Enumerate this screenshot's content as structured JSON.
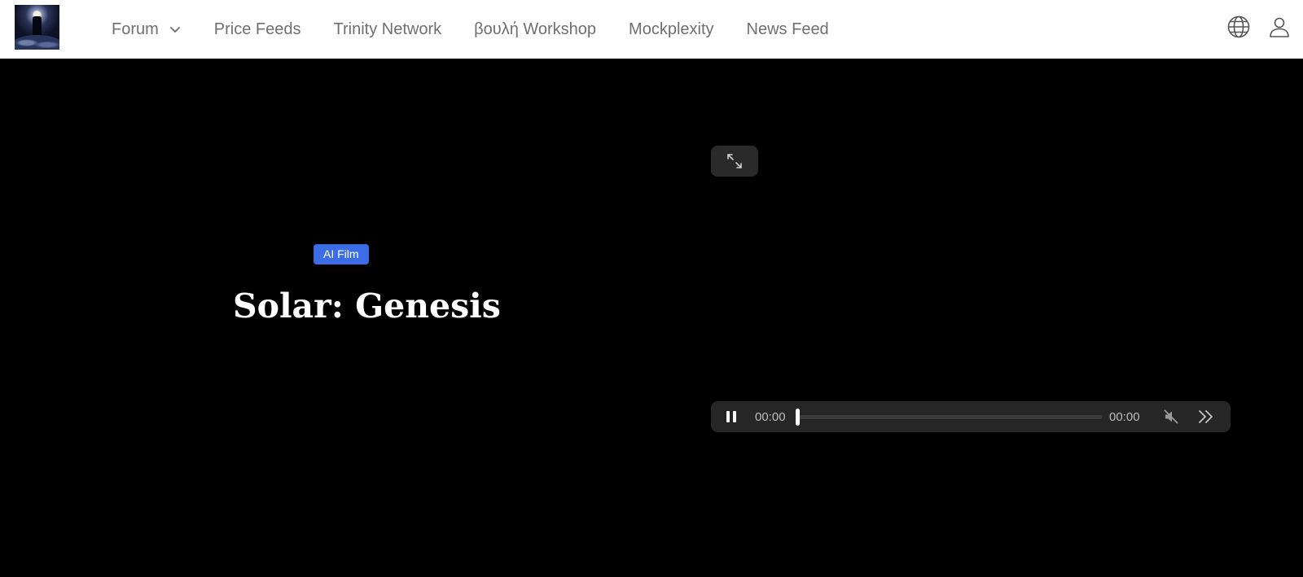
{
  "header": {
    "logo_alt": "",
    "nav": [
      {
        "label": "Forum",
        "has_dropdown": true
      },
      {
        "label": "Price Feeds"
      },
      {
        "label": "Trinity Network"
      },
      {
        "label": "βουλή Workshop"
      },
      {
        "label": "Mockplexity"
      },
      {
        "label": "News Feed"
      }
    ],
    "icons": [
      "globe-icon",
      "user-icon"
    ]
  },
  "hero": {
    "badge": "AI Film",
    "title": "Solar: Genesis"
  },
  "player": {
    "current_time": "00:00",
    "duration": "00:00",
    "progress": 0,
    "state": "playing",
    "muted": true
  },
  "colors": {
    "badge_bg": "#3d6de6",
    "nav_text": "#6f6f6f",
    "hero_bg": "#000000",
    "player_bg": "#262626"
  }
}
